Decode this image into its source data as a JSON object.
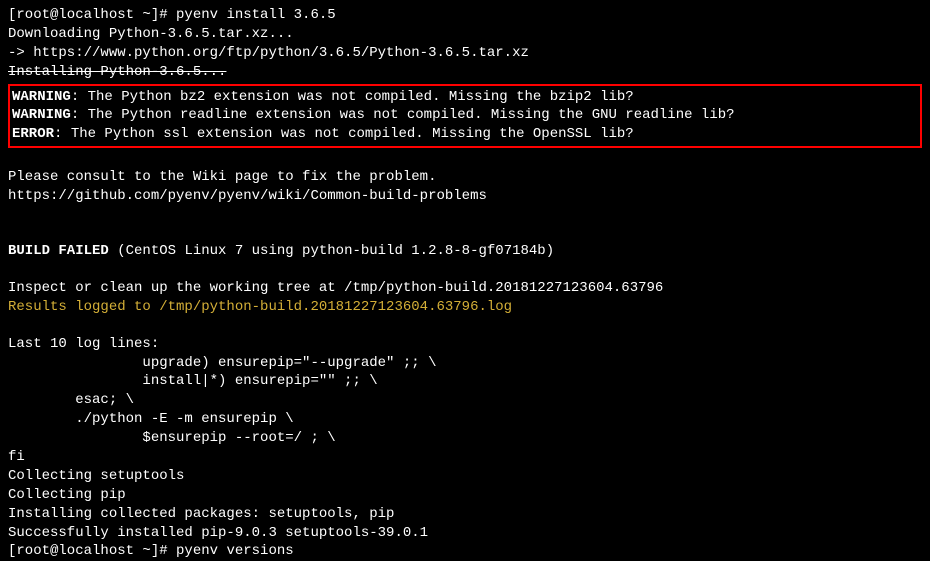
{
  "prompt1_user": "[root@localhost ~]# ",
  "prompt1_cmd": "pyenv install 3.6.5",
  "line_download": "Downloading Python-3.6.5.tar.xz...",
  "line_url": "-> https://www.python.org/ftp/python/3.6.5/Python-3.6.5.tar.xz",
  "line_installing": "Installing Python-3.6.5...",
  "warn1_label": "WARNING",
  "warn1_text": ": The Python bz2 extension was not compiled. Missing the bzip2 lib?",
  "warn2_label": "WARNING",
  "warn2_text": ": The Python readline extension was not compiled. Missing the GNU readline lib?",
  "err1_label": "ERROR",
  "err1_text": ": The Python ssl extension was not compiled. Missing the OpenSSL lib?",
  "line_consult": "Please consult to the Wiki page to fix the problem.",
  "line_wiki": "https://github.com/pyenv/pyenv/wiki/Common-build-problems",
  "build_failed_label": "BUILD FAILED",
  "build_failed_text": " (CentOS Linux 7 using python-build 1.2.8-8-gf07184b)",
  "line_inspect": "Inspect or clean up the working tree at /tmp/python-build.20181227123604.63796",
  "line_results": "Results logged to /tmp/python-build.20181227123604.63796.log",
  "line_last10": "Last 10 log lines:",
  "log1": "                upgrade) ensurepip=\"--upgrade\" ;; \\",
  "log2": "                install|*) ensurepip=\"\" ;; \\",
  "log3": "        esac; \\",
  "log4": "        ./python -E -m ensurepip \\",
  "log5": "                $ensurepip --root=/ ; \\",
  "log6": "fi",
  "log7": "Collecting setuptools",
  "log8": "Collecting pip",
  "log9": "Installing collected packages: setuptools, pip",
  "log10": "Successfully installed pip-9.0.3 setuptools-39.0.1",
  "prompt2_user": "[root@localhost ~]# ",
  "prompt2_cmd": "pyenv versions"
}
